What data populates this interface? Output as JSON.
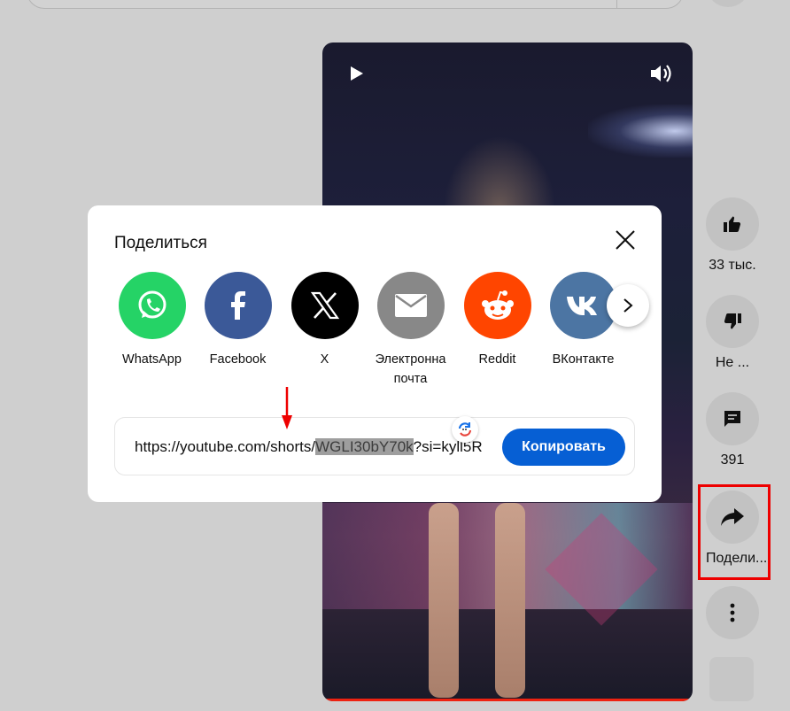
{
  "modal": {
    "title": "Поделиться",
    "targets": [
      {
        "label": "WhatsApp",
        "color": "#25d366",
        "icon": "whatsapp-icon"
      },
      {
        "label": "Facebook",
        "color": "#3b5998",
        "icon": "facebook-icon"
      },
      {
        "label": "X",
        "color": "#000000",
        "icon": "x-icon"
      },
      {
        "label": "Электронна почта",
        "color": "#888888",
        "icon": "email-icon"
      },
      {
        "label": "Reddit",
        "color": "#ff4500",
        "icon": "reddit-icon"
      },
      {
        "label": "ВКонтакте",
        "color": "#4c75a3",
        "icon": "vk-icon"
      }
    ],
    "link": {
      "prefix": "https://youtube.com/shorts/",
      "highlight": "WGLI30bY70k",
      "suffix": "?si=kyll5R"
    },
    "copy_label": "Копировать"
  },
  "actions": {
    "like_count": "33 тыс.",
    "dislike_label": "Не ...",
    "comment_count": "391",
    "share_label": "Подели..."
  },
  "colors": {
    "accent": "#065fd4",
    "annotation": "#e00000",
    "progress": "#ee2211"
  }
}
